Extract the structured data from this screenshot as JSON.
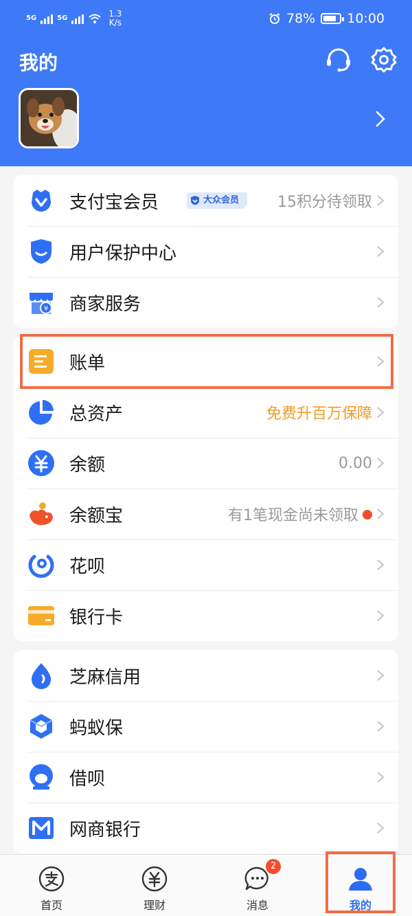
{
  "status_bar": {
    "network_1": "5G",
    "network_2": "5G",
    "speed_value": "1.3",
    "speed_unit": "K/s",
    "battery": "78%",
    "time": "10:00"
  },
  "header": {
    "title": "我的",
    "icons": [
      "customer-service-icon",
      "gear-icon"
    ],
    "accent_color": "#3e79f7"
  },
  "section1": [
    {
      "label": "支付宝会员",
      "badge": "大众会员",
      "trail": "15积分待领取",
      "icon": "member-icon"
    },
    {
      "label": "用户保护中心",
      "trail": "",
      "icon": "shield-icon"
    },
    {
      "label": "商家服务",
      "trail": "",
      "icon": "store-icon"
    }
  ],
  "section2": [
    {
      "label": "账单",
      "trail": "",
      "icon": "bill-icon"
    },
    {
      "label": "总资产",
      "trail": "免费升百万保障",
      "icon": "pie-chart-icon"
    },
    {
      "label": "余额",
      "trail": "0.00",
      "icon": "yuan-icon"
    },
    {
      "label": "余额宝",
      "trail": "有1笔现金尚未领取",
      "icon": "yuebao-icon"
    },
    {
      "label": "花呗",
      "trail": "",
      "icon": "huabei-icon"
    },
    {
      "label": "银行卡",
      "trail": "",
      "icon": "bank-card-icon"
    }
  ],
  "section3": [
    {
      "label": "芝麻信用",
      "trail": "",
      "icon": "sesame-icon"
    },
    {
      "label": "蚂蚁保",
      "trail": "",
      "icon": "antbao-icon"
    },
    {
      "label": "借呗",
      "trail": "",
      "icon": "jiebei-icon"
    },
    {
      "label": "网商银行",
      "trail": "",
      "icon": "mybank-icon"
    }
  ],
  "tabbar": {
    "tabs": [
      {
        "label": "首页",
        "icon": "alipay-icon"
      },
      {
        "label": "理财",
        "icon": "finance-icon"
      },
      {
        "label": "消息",
        "icon": "message-icon",
        "badge": "2"
      },
      {
        "label": "我的",
        "icon": "profile-icon",
        "active": true
      }
    ]
  },
  "colors": {
    "highlight": "#f06d45",
    "active_tab": "#2d6cf2",
    "orange_text": "#f59a23",
    "red_dot": "#f24e2a"
  }
}
